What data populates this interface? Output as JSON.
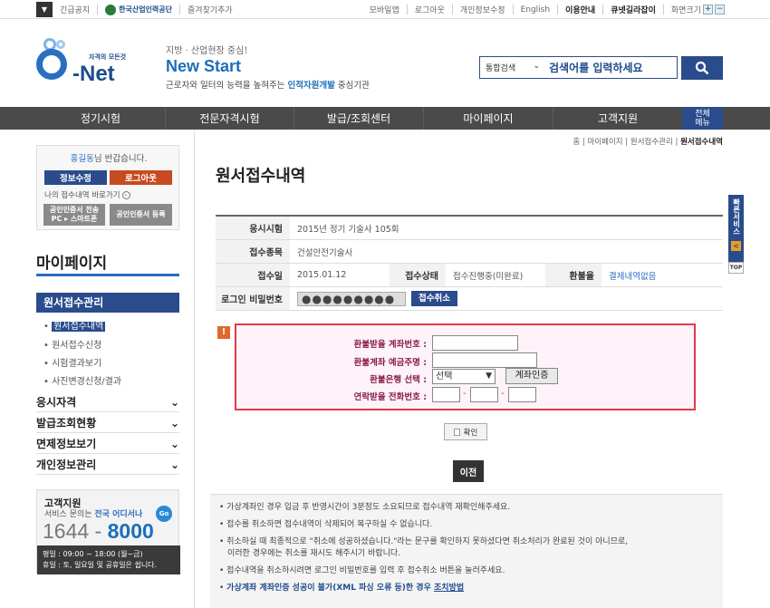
{
  "topbar": {
    "notice": "긴급공지",
    "org": "한국산업인력공단",
    "bookmark": "즐겨찾기추가",
    "links": [
      "모바일앱",
      "로그아웃",
      "개인정보수정",
      "English"
    ],
    "bold_links": [
      "이용안내",
      "큐넷길라잡이"
    ],
    "zoom_label": "화면크기",
    "zoom_in": "+",
    "zoom_out": "−"
  },
  "header": {
    "logo_tag": "자격의 모든것",
    "logo_name": "Net",
    "slogan_1": "지방 · 산업현장 중심!",
    "slogan_2": "New Start",
    "slogan_3a": "근로자와 일터의 능력을 높혀주는 ",
    "slogan_3b": "인적자원개발",
    "slogan_3c": " 중심기관",
    "search_category": "통합검색",
    "search_placeholder": "검색어를 입력하세요"
  },
  "gnb": {
    "items": [
      "정기시험",
      "전문자격시험",
      "발급/조회센터",
      "마이페이지",
      "고객지원"
    ],
    "all_menu_1": "전체",
    "all_menu_2": "메뉴"
  },
  "userbox": {
    "user_name": "홍길동",
    "greeting_suffix": "님 반갑습니다.",
    "edit_label": "정보수정",
    "logout_label": "로그아웃",
    "shortcut_label": "나의 접수내역 바로가기",
    "cert_transfer_1": "공인인증서 전송",
    "cert_transfer_2": "PC ▸ 스마트폰",
    "cert_register": "공인인증서 등록"
  },
  "lnb": {
    "title": "마이페이지",
    "selected": "원서접수관리",
    "subs": [
      "원서접수내역",
      "원서접수신청",
      "시험결과보기",
      "사진변경신청/결과"
    ],
    "menus": [
      "응시자격",
      "발급조회현황",
      "면제정보보기",
      "개인정보관리"
    ]
  },
  "cs": {
    "title": "고객지원",
    "desc_a": "서비스 문의는 ",
    "desc_b": "전국 어디서나",
    "go": "Go",
    "num_a": "1644 - ",
    "num_b": "8000",
    "hours_1": "평일 : 09:00 ~ 18:00 (월~금)",
    "hours_2": "휴일 : 토, 일요일 및 공휴일은 쉽니다."
  },
  "breadcrumb": {
    "items": [
      "홈",
      "마이페이지",
      "원서접수관리"
    ],
    "current": "원서접수내역"
  },
  "page_title": "원서접수내역",
  "info": {
    "exam_label": "응시시험",
    "exam_value": "2015년 정기 기술사 105회",
    "type_label": "접수종목",
    "type_value": "건설안전기술사",
    "date_label": "접수일",
    "date_value": "2015.01.12",
    "status_label": "접수상태",
    "status_value": "접수진행중(미완료)",
    "refund_label": "환불율",
    "refund_value": "결제내역없음",
    "pw_label": "로그인 비밀번호",
    "pw_value": "●●●●●●●●●",
    "cancel_label": "접수취소"
  },
  "alert_icon": "!",
  "refund_form": {
    "account_label": "환불받을 계좌번호 :",
    "holder_label": "환불계좌 예금주명 :",
    "bank_label": "환불은행 선택 :",
    "bank_value": "선택",
    "verify_label": "계좌인증",
    "phone_label": "연락받을 전화번호 :",
    "dash": "-"
  },
  "confirm_label": "확인",
  "prev_label": "이전",
  "notes": [
    "가상계좌인 경우 입금 후 반영시간이 3분정도 소요되므로 접수내역 재확인해주세요.",
    "접수를 취소하면 접수내역이 삭제되어 복구하실 수 없습니다.",
    "취소하실 때 최종적으로 \"취소에 성공하셨습니다.\"라는 문구를 확인하지 못하셨다면 취소처리가 완료된 것이 아니므로,",
    "이러한 경우에는 취소를 재시도 해주시기 바랍니다.",
    "접수내역을 취소하시려면 로그인 비밀번호를 입력 후 접수취소 버튼을 눌러주세요."
  ],
  "note_last_a": "가상계좌 계좌인증 성공이 불가(XML 파싱 오류 등)한 경우 ",
  "note_last_b": "조치방법",
  "quick": {
    "label": "빠른서비스",
    "arrow": "<",
    "top": "TOP"
  }
}
